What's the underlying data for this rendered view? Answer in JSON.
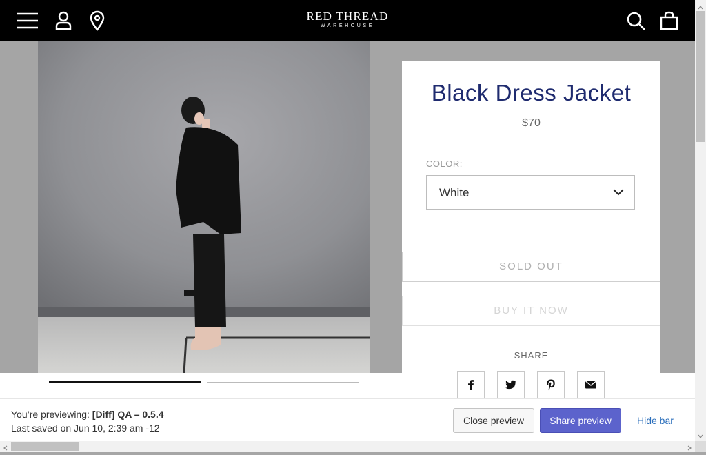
{
  "header": {
    "brand_main": "RED THREAD",
    "brand_sub": "WAREHOUSE",
    "icons": [
      "menu-icon",
      "account-icon",
      "location-icon",
      "search-icon",
      "cart-icon"
    ]
  },
  "product": {
    "title": "Black Dress Jacket",
    "price": "$70",
    "color_label": "COLOR:",
    "color_value": "White",
    "sold_out_label": "SOLD OUT",
    "buy_now_label": "BUY IT NOW",
    "share_label": "SHARE",
    "share_icons": [
      "facebook-icon",
      "twitter-icon",
      "pinterest-icon",
      "email-icon"
    ]
  },
  "gallery": {
    "slides": 2,
    "active_slide": 1
  },
  "preview_bar": {
    "previewing_prefix": "You’re previewing:",
    "theme_name": "[Diff] QA – 0.5.4",
    "last_saved": "Last saved on Jun 10, 2:39 am -12",
    "close_label": "Close preview",
    "share_label": "Share preview",
    "hide_label": "Hide bar"
  },
  "colors": {
    "header_bg": "#000000",
    "title": "#1f2b6f",
    "share_button": "#5c63cc",
    "hide_link": "#2a6ebb"
  }
}
